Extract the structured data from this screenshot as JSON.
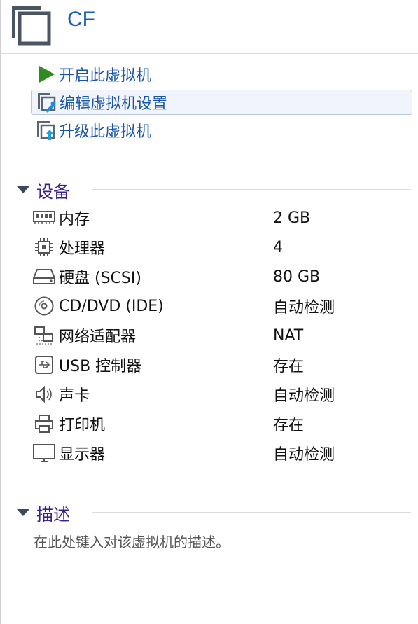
{
  "vm": {
    "title": "CF"
  },
  "actions": [
    {
      "label": "开启此虚拟机",
      "icon": "play-icon"
    },
    {
      "label": "编辑虚拟机设置",
      "icon": "edit-settings-icon"
    },
    {
      "label": "升级此虚拟机",
      "icon": "upgrade-icon"
    }
  ],
  "devices": {
    "title": "设备",
    "items": [
      {
        "name": "内存",
        "value": "2 GB",
        "icon": "memory-icon"
      },
      {
        "name": "处理器",
        "value": "4",
        "icon": "processor-icon"
      },
      {
        "name": "硬盘 (SCSI)",
        "value": "80 GB",
        "icon": "hard-disk-icon"
      },
      {
        "name": "CD/DVD (IDE)",
        "value": "自动检测",
        "icon": "cd-dvd-icon"
      },
      {
        "name": "网络适配器",
        "value": "NAT",
        "icon": "network-adapter-icon"
      },
      {
        "name": "USB 控制器",
        "value": "存在",
        "icon": "usb-icon"
      },
      {
        "name": "声卡",
        "value": "自动检测",
        "icon": "speaker-icon"
      },
      {
        "name": "打印机",
        "value": "存在",
        "icon": "printer-icon"
      },
      {
        "name": "显示器",
        "value": "自动检测",
        "icon": "monitor-icon"
      }
    ]
  },
  "description": {
    "title": "描述",
    "placeholder": "在此处键入对该虚拟机的描述。"
  }
}
